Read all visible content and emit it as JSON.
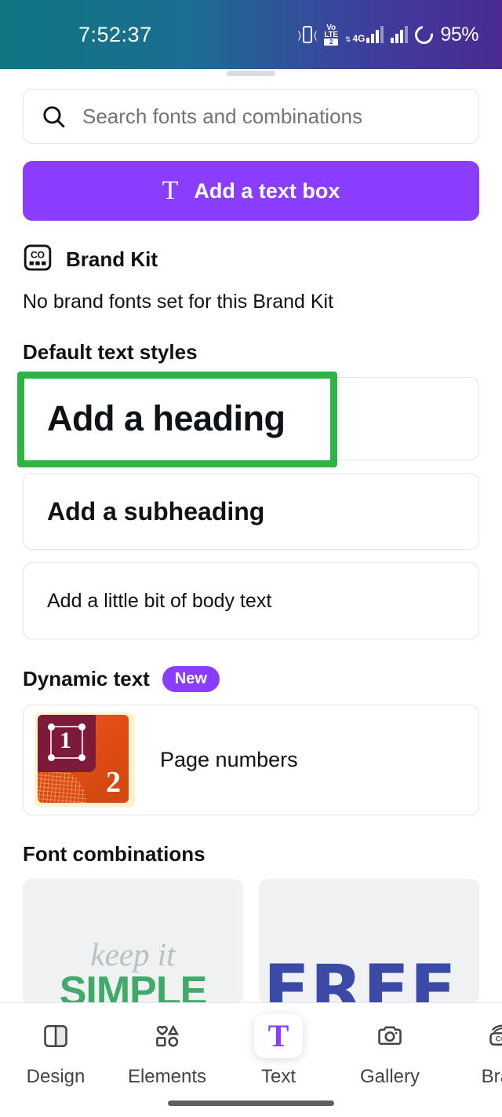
{
  "status_bar": {
    "time": "7:52:37",
    "battery_percent": "95%",
    "icons": {
      "vibrate": "vibrate-icon",
      "volte_line1": "Vo",
      "volte_line2": "LTE",
      "volte_sim": "2",
      "network_type": "4G",
      "signal_1": "signal-bars-icon",
      "signal_2": "signal-bars-icon",
      "battery": "battery-ring-icon"
    },
    "gradient_from": "#0e7680",
    "gradient_to": "#4a2a91"
  },
  "search": {
    "placeholder": "Search fonts and combinations",
    "value": ""
  },
  "add_text_button": {
    "label": "Add a text box",
    "icon": "text-T-icon",
    "color": "#8b3dff"
  },
  "brand_kit": {
    "title": "Brand Kit",
    "icon": "brand-kit-co-icon",
    "note": "No brand fonts set for this Brand Kit"
  },
  "default_text_styles": {
    "section_title": "Default text styles",
    "items": [
      {
        "label": "Add a heading",
        "style": "heading",
        "highlighted": true
      },
      {
        "label": "Add a subheading",
        "style": "subheading",
        "highlighted": false
      },
      {
        "label": "Add a little bit of body text",
        "style": "body",
        "highlighted": false
      }
    ],
    "highlight_color": "#2fb344"
  },
  "dynamic_text": {
    "section_title": "Dynamic text",
    "badge": "New",
    "badge_color": "#8b3dff",
    "items": [
      {
        "label": "Page numbers",
        "thumbnail": {
          "number_one": "1",
          "number_two": "2",
          "bg_color": "#fbf3d0",
          "accent_color": "#e8541c",
          "panel_color": "#7d1a3a"
        }
      }
    ]
  },
  "font_combinations": {
    "section_title": "Font combinations",
    "cards": [
      {
        "line1": "keep it",
        "line2": "SIMPLE",
        "line1_color": "#b9c1c4",
        "line2_color": "#3faa6a"
      },
      {
        "line1": "FREE",
        "line2": "",
        "line1_color": "#3b4aa6",
        "line2_color": "#7fc79a"
      }
    ]
  },
  "bottom_nav": {
    "items": [
      {
        "label": "Design",
        "icon": "design-layout-icon",
        "active": false
      },
      {
        "label": "Elements",
        "icon": "elements-shapes-icon",
        "active": false
      },
      {
        "label": "Text",
        "icon": "text-T-icon",
        "active": true
      },
      {
        "label": "Gallery",
        "icon": "camera-icon",
        "active": false
      },
      {
        "label": "Bran",
        "icon": "brand-kit-co-icon",
        "active": false
      }
    ],
    "active_color": "#8b3dff"
  }
}
